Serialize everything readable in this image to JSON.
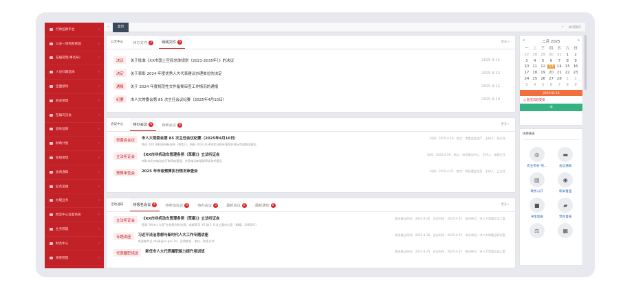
{
  "sidebar": {
    "items": [
      "行政监察平台",
      "三会一课党群管理",
      "在编管理(事务局)",
      "人员归属选择",
      "全面绩效",
      "机关管理",
      "在编司法会",
      "退休监察",
      "财政计划",
      "在线管理",
      "会商通知",
      "业务运维",
      "办理业务",
      "档案中心监督系统",
      "业务管理",
      "财务中心",
      "保密管理",
      "网络办公"
    ]
  },
  "topbar": {
    "home": "首页",
    "close_all": "关闭操作"
  },
  "docs": {
    "title": "公文中心",
    "tabs": [
      {
        "label": "待办文件",
        "badge": "2"
      },
      {
        "label": "待阅文件",
        "badge": "6"
      }
    ],
    "more": "更多>",
    "rows": [
      {
        "tag": "决议",
        "title": "关于批准《XX市国土空间总体规划（2021-2035年）》的决议",
        "date": "2025-4-14"
      },
      {
        "tag": "决定",
        "title": "关于表彰 2024 年度优秀人大代表建议办理单位的决定",
        "date": "2025-4-13"
      },
      {
        "tag": "通报",
        "title": "关于 2024 年度规范性文件备案审查工作情况的通报",
        "date": "2025-4-12"
      },
      {
        "tag": "纪要",
        "title": "市人大常委会第 85 次主任会议纪要（2025年4月10日）",
        "date": "2025-4-10"
      }
    ]
  },
  "meetings": {
    "title": "会议中心",
    "tabs": [
      {
        "label": "待办会议",
        "badge": "6"
      },
      {
        "label": "待参会议",
        "badge": "8"
      }
    ],
    "more": "更多>",
    "rows": [
      {
        "tag": "常委会会议",
        "title": "市人大常委会第 85 次主任会议纪要（2025年4月10日）",
        "sub": "审议《XX 市科技创新条例（草案）》，听取 2024 年环境状况和环境保护目标完成情况报告",
        "meta": "时间：2025-4-18　地点：常委会会议厅　主持人：张主任"
      },
      {
        "tag": "立法听证会",
        "title": "《XX市非机动车管理条例（草案）》立法听证会",
        "sub": "听取市民对电动自行车停放管理、共享电动车管理等条款的意见",
        "meta": "时间：2025-4-20　地点：市民服务中心　主持人：李副主任"
      },
      {
        "tag": "预算审查会",
        "title": "2025 年市级预算执行情况审查会",
        "sub": "",
        "meta": "时间：2025-4-22　地点：财经委会议室　主持人：王主任"
      }
    ]
  },
  "notices": {
    "title": "活动通知",
    "tabs": [
      {
        "label": "待报名会议",
        "badge": "6"
      },
      {
        "label": "待参加会议",
        "badge": "0"
      },
      {
        "label": "待办会议",
        "badge": "3"
      },
      {
        "label": "最新会议",
        "badge": "6"
      },
      {
        "label": "最新通知",
        "badge": "6"
      }
    ],
    "more": "更多>",
    "rows": [
      {
        "tag": "立法听证会",
        "title": "《XX市非机动车管理条例（草案）》立法听证会",
        "sub": "登录“XX市人大网”在线提交报名表，或邮寄至 XX 路 1 号法工委办公室（邮编：200001）",
        "meta": "报名截止时间：2025-4-20　会议时间：2025-4-22　举办单位：市人大常委会法工委"
      },
      {
        "tag": "专题讲座",
        "title": "习近平法治思想与新时代人大工作专题讲座",
        "sub": "发送邮件至 rdxjb@xx.gov.cn，注明姓名、单位、联系方式",
        "meta": "报名截止时间：2025-4-18　会议时间：2025-4-25　举办单位：市人大常委会研究室"
      },
      {
        "tag": "代表履职培训",
        "title": "新任市人大代表履职能力提升培训班",
        "sub": "",
        "meta": "报名截止时间：2025-4-25　会议时间：2025-4-27　举办单位：市人大常委会选工委"
      }
    ]
  },
  "calendar": {
    "title": "二月 2025",
    "weekdays": [
      "一",
      "二",
      "三",
      "四",
      "五",
      "六",
      "日"
    ],
    "days": [
      "27",
      "28",
      "29",
      "30",
      "31",
      "1",
      "2",
      "3",
      "4",
      "5",
      "6",
      "7",
      "8",
      "9",
      "10",
      "11",
      "12",
      "13",
      "14",
      "15",
      "16",
      "17",
      "18",
      "19",
      "20",
      "21",
      "22",
      "23",
      "24",
      "25",
      "26",
      "27",
      "28",
      "1",
      "2",
      "3",
      "4",
      "5",
      "6",
      "7",
      "8",
      "9"
    ],
    "today_index": 17,
    "selected_date": "2025-02-13",
    "no_schedule": "◎ 暂无日程安排",
    "add": "+"
  },
  "quick": {
    "title": "快捷通道",
    "items": [
      {
        "label": "农业农村-项...",
        "icon": "pill-icon",
        "glyph": "◎"
      },
      {
        "label": "会议通知",
        "icon": "folder-icon",
        "glyph": "▬"
      },
      {
        "label": "政务公开",
        "icon": "chart-icon",
        "glyph": "▥"
      },
      {
        "label": "新录督查",
        "icon": "target-icon",
        "glyph": "◉"
      },
      {
        "label": "决策督查",
        "icon": "bookmark-icon",
        "glyph": "■"
      },
      {
        "label": "党办督查",
        "icon": "book-icon",
        "glyph": "▰"
      },
      {
        "label": "",
        "icon": "scale-icon",
        "glyph": "⚖"
      },
      {
        "label": "",
        "icon": "grid-icon",
        "glyph": "▦"
      }
    ]
  }
}
